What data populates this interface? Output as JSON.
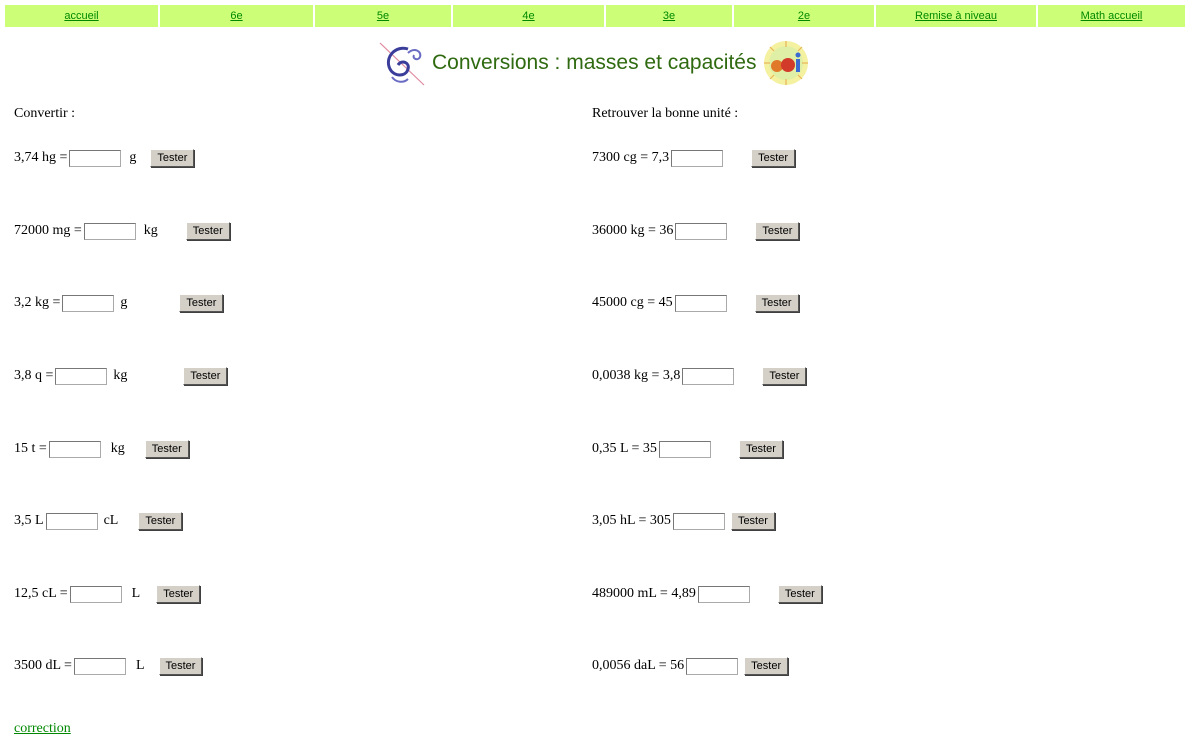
{
  "nav": [
    "accueil",
    "6e",
    "5e",
    "4e",
    "3e",
    "2e",
    "Remise à niveau",
    "Math accueil"
  ],
  "title": "Conversions : masses et capacités",
  "left": {
    "heading": "Convertir :",
    "rows": [
      {
        "label": "3,74 hg =",
        "unit": "g",
        "button": "Tester"
      },
      {
        "label": "72000 mg =",
        "unit": "kg",
        "button": "Tester"
      },
      {
        "label": "3,2 kg =",
        "unit": "g",
        "button": "Tester"
      },
      {
        "label": "3,8 q =",
        "unit": "kg",
        "button": "Tester"
      },
      {
        "label": "15 t =",
        "unit": "kg",
        "button": "Tester"
      },
      {
        "label": "3,5 L",
        "unit": "cL",
        "button": "Tester"
      },
      {
        "label": "12,5 cL =",
        "unit": "L",
        "button": "Tester"
      },
      {
        "label": "3500 dL =",
        "unit": "L",
        "button": "Tester"
      }
    ]
  },
  "right": {
    "heading": "Retrouver la bonne unité :",
    "rows": [
      {
        "label": "7300 cg = 7,3",
        "button": "Tester"
      },
      {
        "label": "36000 kg = 36",
        "button": "Tester"
      },
      {
        "label": "45000 cg = 45",
        "button": "Tester"
      },
      {
        "label": "0,0038 kg = 3,8",
        "button": "Tester"
      },
      {
        "label": "0,35 L = 35",
        "button": "Tester"
      },
      {
        "label": "3,05 hL = 305",
        "button": "Tester"
      },
      {
        "label": "489000 mL = 4,89",
        "button": "Tester"
      },
      {
        "label": "0,0056 daL = 56",
        "button": "Tester"
      }
    ]
  },
  "correction": "correction",
  "colors": {
    "nav_bg": "#ccff77",
    "link": "#008800",
    "title": "#2f6a10"
  },
  "icons": {
    "left_logo": "swirl-logo-icon",
    "right_logo": "eoi-logo-icon"
  }
}
